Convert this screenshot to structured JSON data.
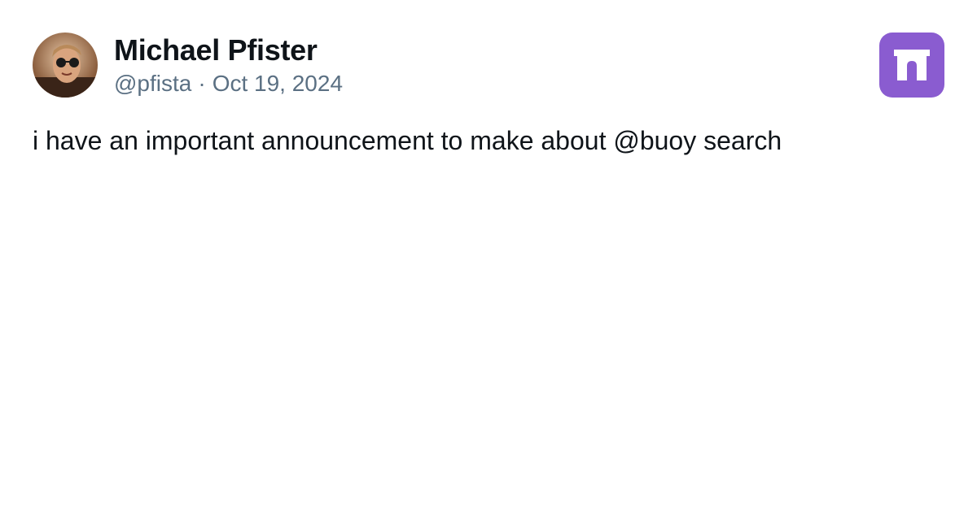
{
  "author": {
    "name": "Michael Pfister",
    "handle": "@pfista",
    "separator": "·",
    "date": "Oct 19, 2024",
    "avatar_icon": "profile-photo"
  },
  "post": {
    "text": "i have an important announcement to make about @buoy search"
  },
  "app": {
    "logo_icon": "arch-logo-icon",
    "logo_color": "#8a5cd0"
  },
  "colors": {
    "name": "#0f1419",
    "meta": "#5b7083",
    "body": "#0f1419",
    "background": "#ffffff"
  }
}
